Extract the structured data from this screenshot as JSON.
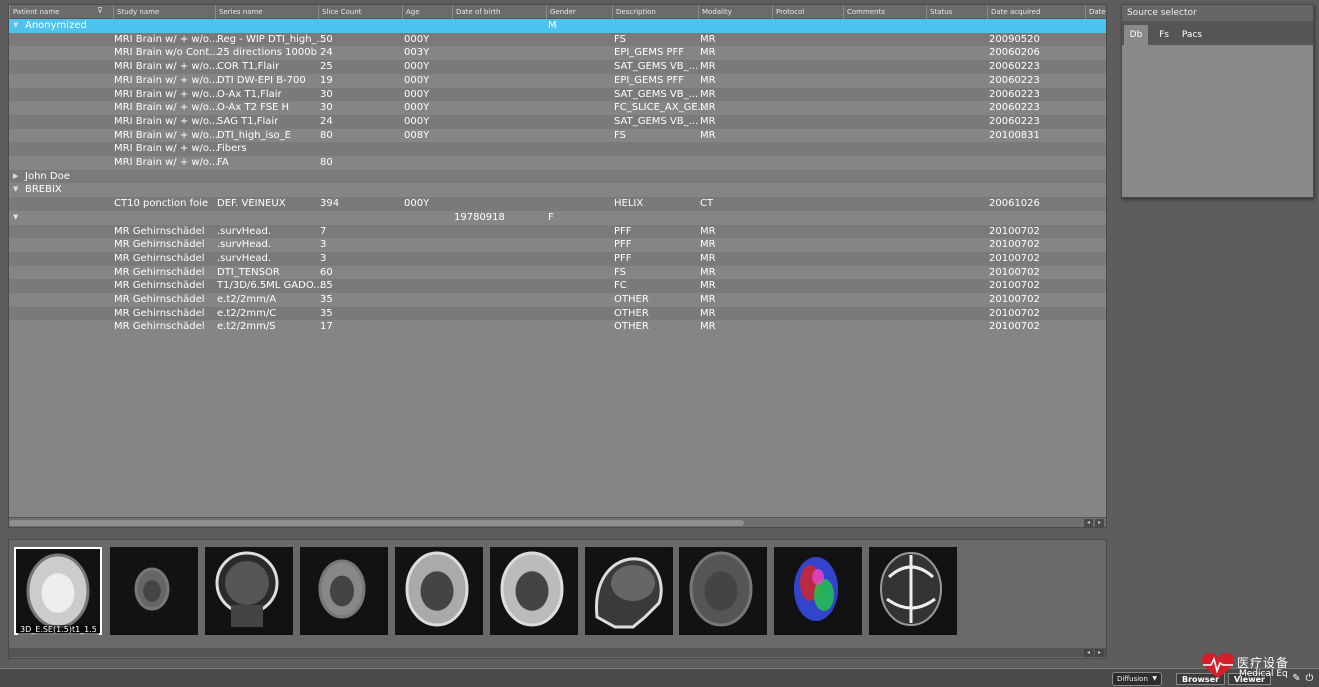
{
  "db_browser": {
    "columns": [
      "Patient name",
      "Study name",
      "Series name",
      "Slice Count",
      "Age",
      "Date of birth",
      "Gender",
      "Description",
      "Modality",
      "Protocol",
      "Comments",
      "Status",
      "Date acquired",
      "Date i"
    ],
    "rows": [
      {
        "kind": "patient",
        "expanded": true,
        "selected": true,
        "patient": "Anonymized",
        "study": "",
        "series": "",
        "slices": "",
        "age": "",
        "dob": "",
        "gender": "M",
        "desc": "",
        "modality": "",
        "date": ""
      },
      {
        "kind": "series",
        "patient": "",
        "study": "MRI Brain w/ + w/o...",
        "series": "Reg - WIP DTI_high_...",
        "slices": "50",
        "age": "000Y",
        "dob": "",
        "gender": "",
        "desc": "FS",
        "modality": "MR",
        "date": "20090520"
      },
      {
        "kind": "series",
        "patient": "",
        "study": "MRI Brain w/o Cont...",
        "series": "25 directions 1000b",
        "slices": "24",
        "age": "003Y",
        "dob": "",
        "gender": "",
        "desc": "EPI_GEMS PFF",
        "modality": "MR",
        "date": "20060206"
      },
      {
        "kind": "series",
        "patient": "",
        "study": "MRI Brain w/ + w/o...",
        "series": "COR T1,Flair",
        "slices": "25",
        "age": "000Y",
        "dob": "",
        "gender": "",
        "desc": "SAT_GEMS VB_...",
        "modality": "MR",
        "date": "20060223"
      },
      {
        "kind": "series",
        "patient": "",
        "study": "MRI Brain w/ + w/o...",
        "series": "DTI DW-EPI B-700",
        "slices": "19",
        "age": "000Y",
        "dob": "",
        "gender": "",
        "desc": "EPI_GEMS PFF",
        "modality": "MR",
        "date": "20060223"
      },
      {
        "kind": "series",
        "patient": "",
        "study": "MRI Brain w/ + w/o...",
        "series": "O-Ax T1,Flair",
        "slices": "30",
        "age": "000Y",
        "dob": "",
        "gender": "",
        "desc": "SAT_GEMS VB_...",
        "modality": "MR",
        "date": "20060223"
      },
      {
        "kind": "series",
        "patient": "",
        "study": "MRI Brain w/ + w/o...",
        "series": "O-Ax T2 FSE H",
        "slices": "30",
        "age": "000Y",
        "dob": "",
        "gender": "",
        "desc": "FC_SLICE_AX_GE...",
        "modality": "MR",
        "date": "20060223"
      },
      {
        "kind": "series",
        "patient": "",
        "study": "MRI Brain w/ + w/o...",
        "series": "SAG T1,Flair",
        "slices": "24",
        "age": "000Y",
        "dob": "",
        "gender": "",
        "desc": "SAT_GEMS VB_...",
        "modality": "MR",
        "date": "20060223"
      },
      {
        "kind": "series",
        "patient": "",
        "study": "MRI Brain w/ + w/o...",
        "series": "DTI_high_iso_E",
        "slices": "80",
        "age": "008Y",
        "dob": "",
        "gender": "",
        "desc": "FS",
        "modality": "MR",
        "date": "20100831"
      },
      {
        "kind": "series",
        "patient": "",
        "study": "MRI Brain w/ + w/o...",
        "series": "Fibers",
        "slices": "",
        "age": "",
        "dob": "",
        "gender": "",
        "desc": "",
        "modality": "",
        "date": ""
      },
      {
        "kind": "series",
        "patient": "",
        "study": "MRI Brain w/ + w/o...",
        "series": "FA",
        "slices": "80",
        "age": "",
        "dob": "",
        "gender": "",
        "desc": "",
        "modality": "",
        "date": ""
      },
      {
        "kind": "patient",
        "expanded": false,
        "selected": false,
        "patient": "John Doe",
        "study": "",
        "series": "",
        "slices": "",
        "age": "",
        "dob": "",
        "gender": "",
        "desc": "",
        "modality": "",
        "date": ""
      },
      {
        "kind": "patient",
        "expanded": true,
        "selected": false,
        "patient": "BREBIX",
        "study": "",
        "series": "",
        "slices": "",
        "age": "",
        "dob": "",
        "gender": "",
        "desc": "",
        "modality": "",
        "date": ""
      },
      {
        "kind": "series",
        "patient": "",
        "study": "CT10 ponction foie",
        "series": "DEF. VEINEUX",
        "slices": "394",
        "age": "000Y",
        "dob": "",
        "gender": "",
        "desc": "HELIX",
        "modality": "CT",
        "date": "20061026"
      },
      {
        "kind": "patient",
        "expanded": true,
        "selected": false,
        "patient": "",
        "study": "",
        "series": "",
        "slices": "",
        "age": "",
        "dob": "19780918",
        "gender": "F",
        "desc": "",
        "modality": "",
        "date": ""
      },
      {
        "kind": "series",
        "patient": "",
        "study": "MR Gehirnschädel",
        "series": ".survHead.",
        "slices": "7",
        "age": "",
        "dob": "",
        "gender": "",
        "desc": "PFF",
        "modality": "MR",
        "date": "20100702"
      },
      {
        "kind": "series",
        "patient": "",
        "study": "MR Gehirnschädel",
        "series": ".survHead.",
        "slices": "3",
        "age": "",
        "dob": "",
        "gender": "",
        "desc": "PFF",
        "modality": "MR",
        "date": "20100702"
      },
      {
        "kind": "series",
        "patient": "",
        "study": "MR Gehirnschädel",
        "series": ".survHead.",
        "slices": "3",
        "age": "",
        "dob": "",
        "gender": "",
        "desc": "PFF",
        "modality": "MR",
        "date": "20100702"
      },
      {
        "kind": "series",
        "patient": "",
        "study": "MR Gehirnschädel",
        "series": "DTI_TENSOR",
        "slices": "60",
        "age": "",
        "dob": "",
        "gender": "",
        "desc": "FS",
        "modality": "MR",
        "date": "20100702"
      },
      {
        "kind": "series",
        "patient": "",
        "study": "MR Gehirnschädel",
        "series": "T1/3D/6.5ML GADO...",
        "slices": "85",
        "age": "",
        "dob": "",
        "gender": "",
        "desc": "FC",
        "modality": "MR",
        "date": "20100702"
      },
      {
        "kind": "series",
        "patient": "",
        "study": "MR Gehirnschädel",
        "series": "e.t2/2mm/A",
        "slices": "35",
        "age": "",
        "dob": "",
        "gender": "",
        "desc": "OTHER",
        "modality": "MR",
        "date": "20100702"
      },
      {
        "kind": "series",
        "patient": "",
        "study": "MR Gehirnschädel",
        "series": "e.t2/2mm/C",
        "slices": "35",
        "age": "",
        "dob": "",
        "gender": "",
        "desc": "OTHER",
        "modality": "MR",
        "date": "20100702"
      },
      {
        "kind": "series",
        "patient": "",
        "study": "MR Gehirnschädel",
        "series": "e.t2/2mm/S",
        "slices": "17",
        "age": "",
        "dob": "",
        "gender": "",
        "desc": "OTHER",
        "modality": "MR",
        "date": "20100702"
      }
    ]
  },
  "source_selector": {
    "title": "Source selector",
    "tabs": [
      "Db",
      "Fs",
      "Pacs"
    ],
    "active_tab": "Db"
  },
  "thumbnails": {
    "items": [
      {
        "name": "axial-brain-bright",
        "caption": "3D_E.SE(1.5)t1_1.5",
        "selected": true
      },
      {
        "name": "axial-brain-small",
        "caption": "",
        "selected": false
      },
      {
        "name": "coronal-head",
        "caption": "",
        "selected": false
      },
      {
        "name": "axial-brain-gray",
        "caption": "",
        "selected": false
      },
      {
        "name": "axial-brain-t1",
        "caption": "",
        "selected": false
      },
      {
        "name": "axial-brain-t2",
        "caption": "",
        "selected": false
      },
      {
        "name": "sagittal-head",
        "caption": "",
        "selected": false
      },
      {
        "name": "axial-brain-dwi",
        "caption": "",
        "selected": false
      },
      {
        "name": "axial-brain-color-fa",
        "caption": "",
        "selected": false
      },
      {
        "name": "axial-brain-fa",
        "caption": "",
        "selected": false
      }
    ]
  },
  "statusbar": {
    "mode_value": "Diffusion",
    "browser_label": "Browser",
    "viewer_label": "Viewer",
    "logo_text": "医疗设备",
    "logo_sub": "Medical Eq"
  }
}
